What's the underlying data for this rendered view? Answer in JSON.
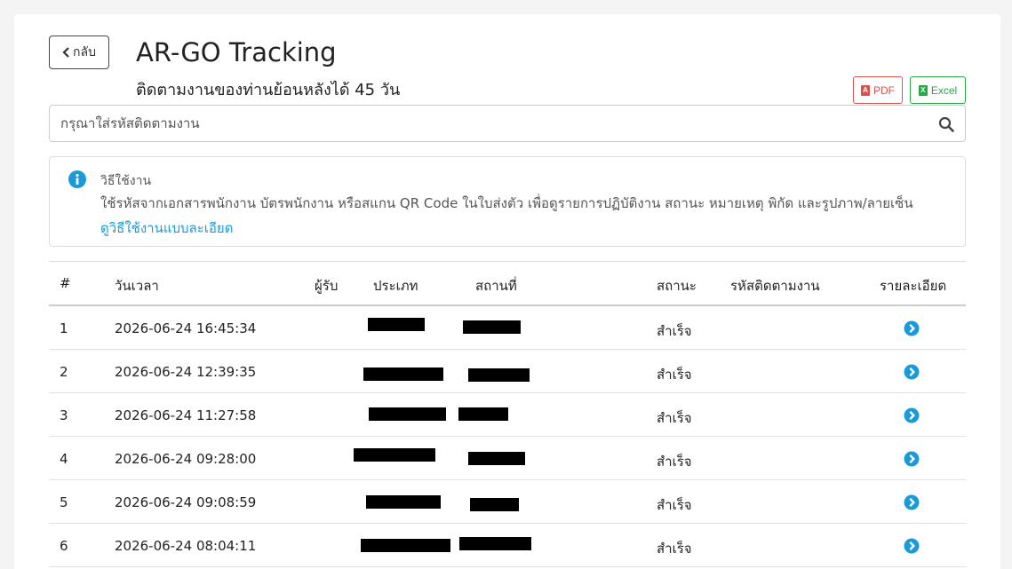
{
  "header": {
    "back_label": "กลับ",
    "title": "AR-GO Tracking",
    "subtitle": "ติดตามงานของท่านย้อนหลังได้ 45 วัน",
    "pdf_label": "PDF",
    "excel_label": "Excel"
  },
  "search": {
    "placeholder": "กรุณาใส่รหัสติดตามงาน",
    "value": ""
  },
  "help": {
    "title": "วิธีใช้งาน",
    "description": "ใช้รหัสจากเอกสารพนักงาน บัตรพนักงาน หรือสแกน QR Code ในใบส่งตัว เพื่อดูรายการปฏิบัติงาน สถานะ หมายเหตุ พิกัด และรูปภาพ/ลายเซ็น",
    "link": "ดูวิธีใช้งานแบบละเอียด"
  },
  "table": {
    "columns": [
      "#",
      "วันเวลา",
      "ผู้รับ",
      "ประเภท",
      "สถานที่",
      "สถานะ",
      "รหัสติดตามงาน",
      "รายละเอียด"
    ],
    "rows": [
      {
        "no": "1",
        "datetime": "2026-06-24 16:45:34",
        "receiver": "",
        "status": "สำเร็จ",
        "tracking": ""
      },
      {
        "no": "2",
        "datetime": "2026-06-24 12:39:35",
        "receiver": "",
        "status": "สำเร็จ",
        "tracking": ""
      },
      {
        "no": "3",
        "datetime": "2026-06-24 11:27:58",
        "receiver": "",
        "status": "สำเร็จ",
        "tracking": ""
      },
      {
        "no": "4",
        "datetime": "2026-06-24 09:28:00",
        "receiver": "",
        "status": "สำเร็จ",
        "tracking": ""
      },
      {
        "no": "5",
        "datetime": "2026-06-24 09:08:59",
        "receiver": "",
        "status": "สำเร็จ",
        "tracking": ""
      },
      {
        "no": "6",
        "datetime": "2026-06-24 08:04:11",
        "receiver": "",
        "status": "สำเร็จ",
        "tracking": ""
      }
    ]
  },
  "colors": {
    "accent": "#1a9bd7",
    "pdf": "#d9534f",
    "excel": "#28a745"
  }
}
